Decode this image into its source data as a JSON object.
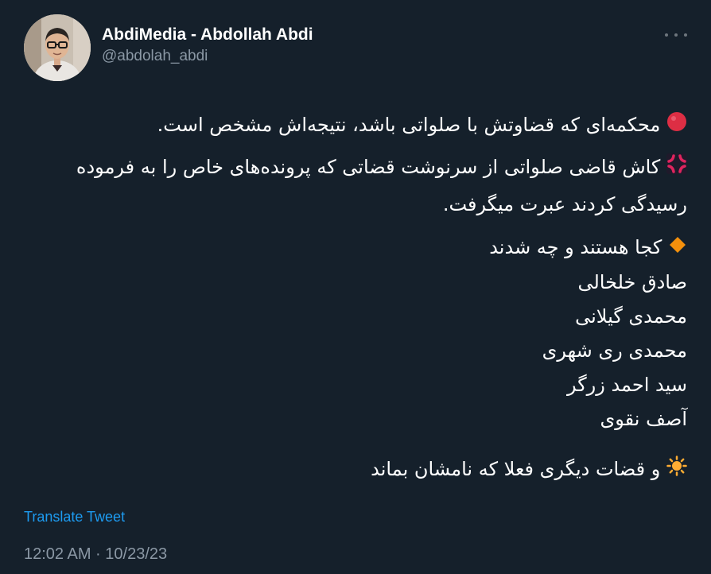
{
  "author": {
    "display_name": "AbdiMedia - Abdollah Abdi",
    "handle": "@abdolah_abdi"
  },
  "tweet": {
    "paragraph_1": "محکمه‌ای که قضاوتش با صلواتی باشد، نتیجه‌اش مشخص است.",
    "paragraph_2": "کاش قاضی صلواتی از سرنوشت قضاتی که پرونده‌های خاص را به فرموده رسیدگی کردند عبرت میگرفت.",
    "list_heading": "کجا هستند و چه شدند",
    "names": [
      "صادق خلخالی",
      "محمدی گیلانی",
      "محمدی ری شهری",
      "سید احمد زرگر",
      "آصف نقوی"
    ],
    "paragraph_4": "و قضات دیگری  فعلا که نامشان بماند"
  },
  "icons": {
    "red_circle": "red-circle-emoji",
    "anger_symbol": "anger-symbol-emoji",
    "orange_diamond": "orange-diamond-emoji",
    "sun": "sun-emoji",
    "more": "more-icon"
  },
  "actions": {
    "translate_label": "Translate Tweet"
  },
  "meta": {
    "timestamp": "12:02 AM · 10/23/23"
  },
  "colors": {
    "background": "#15202b",
    "text_primary": "#ffffff",
    "text_secondary": "#8b98a5",
    "link": "#1d9bf0"
  }
}
